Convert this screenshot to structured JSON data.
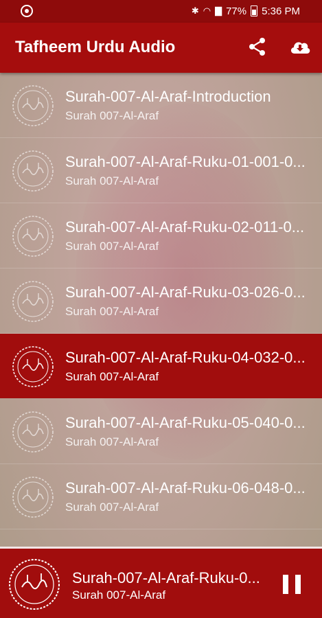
{
  "status_bar": {
    "battery": "77%",
    "time": "5:36 PM"
  },
  "app_bar": {
    "title": "Tafheem Urdu Audio",
    "share_icon": "share-icon",
    "download_icon": "cloud-download-icon"
  },
  "tracks": [
    {
      "title": "Surah-007-Al-Araf-Introduction",
      "subtitle": "Surah 007-Al-Araf",
      "active": false
    },
    {
      "title": "Surah-007-Al-Araf-Ruku-01-001-0...",
      "subtitle": "Surah 007-Al-Araf",
      "active": false
    },
    {
      "title": "Surah-007-Al-Araf-Ruku-02-011-0...",
      "subtitle": "Surah 007-Al-Araf",
      "active": false
    },
    {
      "title": "Surah-007-Al-Araf-Ruku-03-026-0...",
      "subtitle": "Surah 007-Al-Araf",
      "active": false
    },
    {
      "title": "Surah-007-Al-Araf-Ruku-04-032-0...",
      "subtitle": "Surah 007-Al-Araf",
      "active": true
    },
    {
      "title": "Surah-007-Al-Araf-Ruku-05-040-0...",
      "subtitle": "Surah 007-Al-Araf",
      "active": false
    },
    {
      "title": "Surah-007-Al-Araf-Ruku-06-048-0...",
      "subtitle": "Surah 007-Al-Araf",
      "active": false
    }
  ],
  "now_playing": {
    "title": "Surah-007-Al-Araf-Ruku-0...",
    "subtitle": "Surah 007-Al-Araf",
    "control_icon": "pause-icon"
  },
  "colors": {
    "primary": "#a50d0d",
    "status_bar": "#8e0b0b",
    "active_row": "#a10d0d"
  }
}
